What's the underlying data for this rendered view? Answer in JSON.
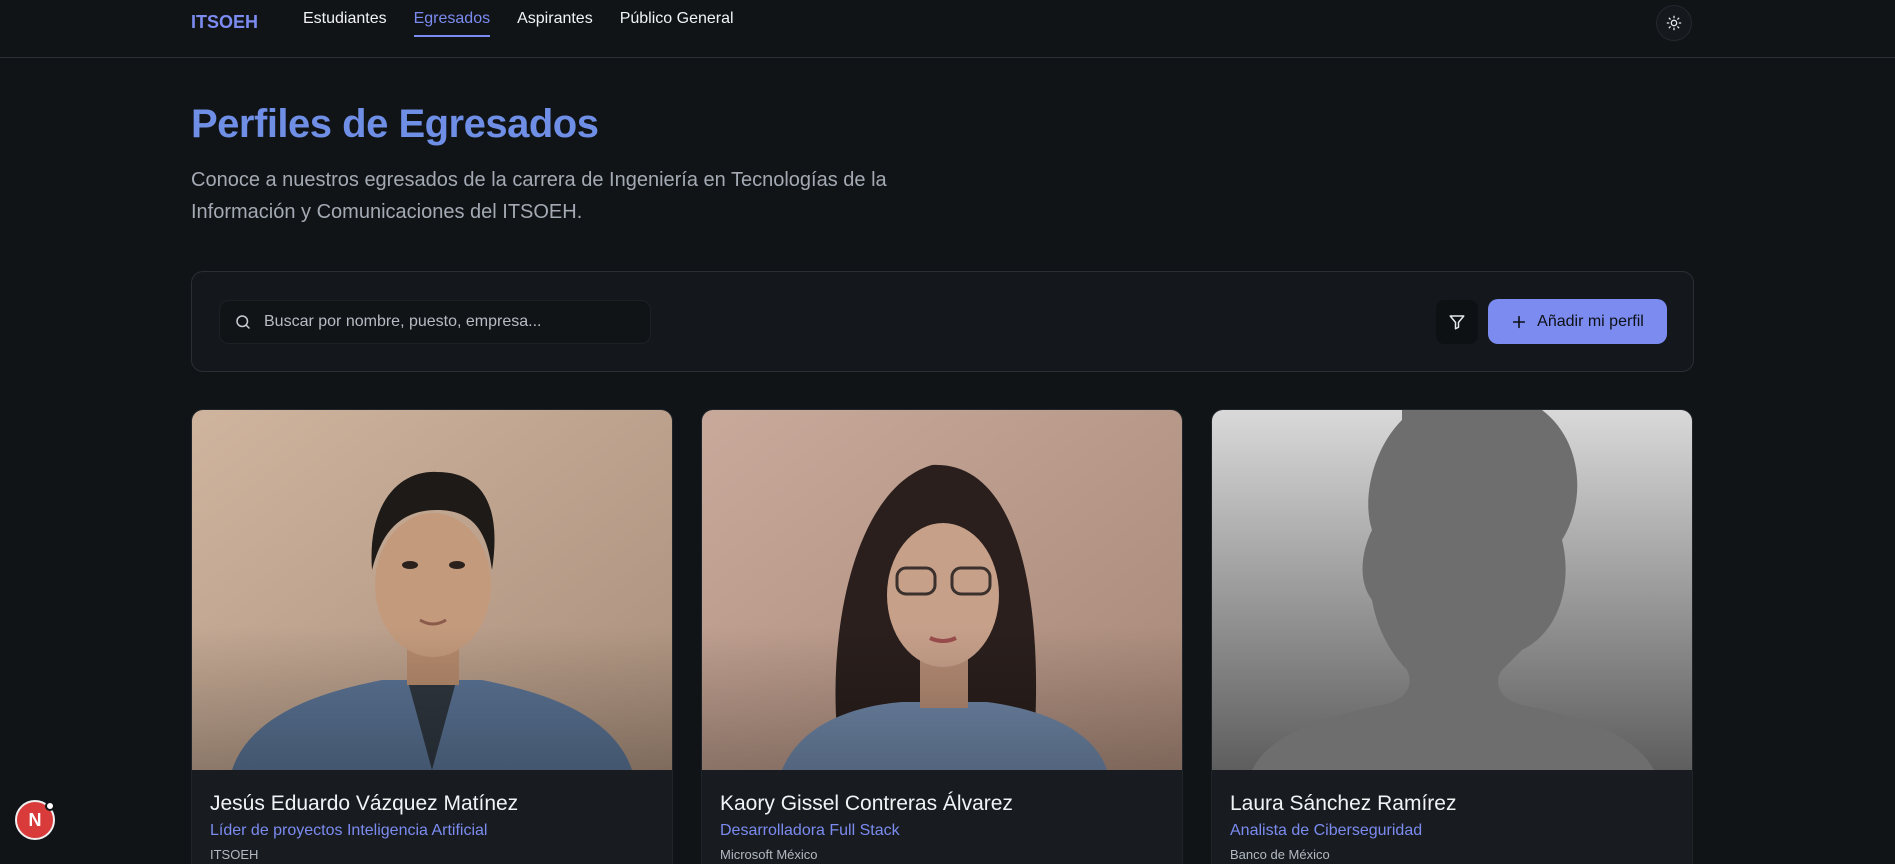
{
  "header": {
    "brand": "ITSOEH",
    "nav": [
      {
        "label": "Estudiantes",
        "active": false
      },
      {
        "label": "Egresados",
        "active": true
      },
      {
        "label": "Aspirantes",
        "active": false
      },
      {
        "label": "Público General",
        "active": false
      }
    ],
    "theme_toggle_icon": "sun-icon"
  },
  "hero": {
    "title": "Perfiles de Egresados",
    "subtitle": "Conoce a nuestros egresados de la carrera de Ingeniería en Tecnologías de la Información y Comunicaciones del ITSOEH."
  },
  "toolbar": {
    "search_placeholder": "Buscar por nombre, puesto, empresa...",
    "search_icon": "search-icon",
    "filter_icon": "filter-icon",
    "add_label": "Añadir mi perfil",
    "add_icon": "plus-icon"
  },
  "profiles": [
    {
      "name": "Jesús Eduardo Vázquez Matínez",
      "role": "Líder de proyectos Inteligencia Artificial",
      "company": "ITSOEH",
      "photo": "portrait"
    },
    {
      "name": "Kaory Gissel Contreras Álvarez",
      "role": "Desarrolladora Full Stack",
      "company": "Microsoft México",
      "photo": "portrait"
    },
    {
      "name": "Laura Sánchez Ramírez",
      "role": "Analista de Ciberseguridad",
      "company": "Banco de México",
      "photo": "placeholder-silhouette"
    }
  ],
  "badge": {
    "label": "N"
  },
  "colors": {
    "accent": "#7b8bef",
    "title": "#6f8ee6",
    "background": "#111417"
  }
}
